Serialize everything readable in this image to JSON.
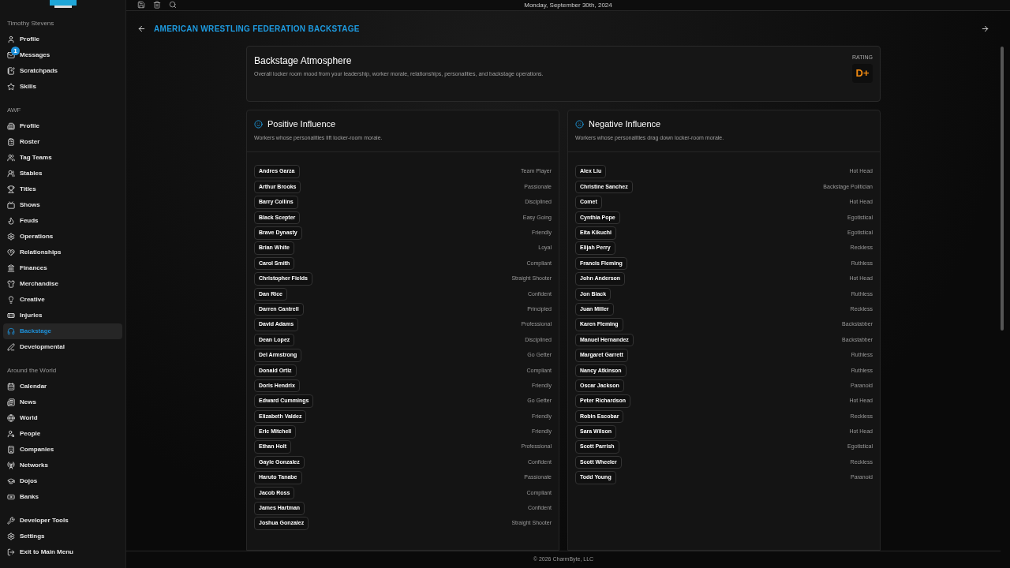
{
  "topbar": {
    "date": "Monday, September 30th, 2024"
  },
  "sidebar": {
    "sections": [
      {
        "title": "Timothy Stevens",
        "items": [
          {
            "label": "Profile",
            "selected": false
          },
          {
            "label": "Messages",
            "selected": false,
            "badge": "1"
          },
          {
            "label": "Scratchpads",
            "selected": false
          },
          {
            "label": "Skills",
            "selected": false
          }
        ]
      },
      {
        "title": "AWF",
        "items": [
          {
            "label": "Profile",
            "selected": false
          },
          {
            "label": "Roster",
            "selected": false
          },
          {
            "label": "Tag Teams",
            "selected": false
          },
          {
            "label": "Stables",
            "selected": false
          },
          {
            "label": "Titles",
            "selected": false
          },
          {
            "label": "Shows",
            "selected": false
          },
          {
            "label": "Feuds",
            "selected": false
          },
          {
            "label": "Operations",
            "selected": false
          },
          {
            "label": "Relationships",
            "selected": false
          },
          {
            "label": "Finances",
            "selected": false
          },
          {
            "label": "Merchandise",
            "selected": false
          },
          {
            "label": "Creative",
            "selected": false
          },
          {
            "label": "Injuries",
            "selected": false
          },
          {
            "label": "Backstage",
            "selected": true
          },
          {
            "label": "Developmental",
            "selected": false
          }
        ]
      },
      {
        "title": "Around the World",
        "items": [
          {
            "label": "Calendar",
            "selected": false
          },
          {
            "label": "News",
            "selected": false
          },
          {
            "label": "World",
            "selected": false
          },
          {
            "label": "People",
            "selected": false
          },
          {
            "label": "Companies",
            "selected": false
          },
          {
            "label": "Networks",
            "selected": false
          },
          {
            "label": "Dojos",
            "selected": false
          },
          {
            "label": "Banks",
            "selected": false
          }
        ]
      },
      {
        "items": [
          {
            "label": "Developer Tools",
            "selected": false
          },
          {
            "label": "Settings",
            "selected": false
          },
          {
            "label": "Exit to Main Menu",
            "selected": false
          }
        ]
      }
    ]
  },
  "page": {
    "title": "AMERICAN WRESTLING FEDERATION BACKSTAGE"
  },
  "atmosphere": {
    "title": "Backstage Atmosphere",
    "description": "Overall locker room mood from your leadership, worker morale, relationships, personalities, and backstage operations.",
    "rating_label": "RATING",
    "rating": "D+"
  },
  "columns": [
    {
      "title": "Positive Influence",
      "subtitle": "Workers whose personalities lift locker-room morale.",
      "rows": [
        {
          "name": "Andres Garza",
          "trait": "Team Player"
        },
        {
          "name": "Arthur Brooks",
          "trait": "Passionate"
        },
        {
          "name": "Barry Collins",
          "trait": "Disciplined"
        },
        {
          "name": "Black Scepter",
          "trait": "Easy Going"
        },
        {
          "name": "Brave Dynasty",
          "trait": "Friendly"
        },
        {
          "name": "Brian White",
          "trait": "Loyal"
        },
        {
          "name": "Carol Smith",
          "trait": "Compliant"
        },
        {
          "name": "Christopher Fields",
          "trait": "Straight Shooter"
        },
        {
          "name": "Dan Rice",
          "trait": "Confident"
        },
        {
          "name": "Darren Cantrell",
          "trait": "Principled"
        },
        {
          "name": "David Adams",
          "trait": "Professional"
        },
        {
          "name": "Dean Lopez",
          "trait": "Disciplined"
        },
        {
          "name": "Del Armstrong",
          "trait": "Go Getter"
        },
        {
          "name": "Donald Ortiz",
          "trait": "Compliant"
        },
        {
          "name": "Doris Hendrix",
          "trait": "Friendly"
        },
        {
          "name": "Edward Cummings",
          "trait": "Go Getter"
        },
        {
          "name": "Elizabeth Valdez",
          "trait": "Friendly"
        },
        {
          "name": "Eric Mitchell",
          "trait": "Friendly"
        },
        {
          "name": "Ethan Holt",
          "trait": "Professional"
        },
        {
          "name": "Gayle Gonzalez",
          "trait": "Confident"
        },
        {
          "name": "Haruto Tanabe",
          "trait": "Passionate"
        },
        {
          "name": "Jacob Ross",
          "trait": "Compliant"
        },
        {
          "name": "James Hartman",
          "trait": "Confident"
        },
        {
          "name": "Joshua Gonzalez",
          "trait": "Straight Shooter"
        }
      ]
    },
    {
      "title": "Negative Influence",
      "subtitle": "Workers whose personalities drag down locker-room morale.",
      "rows": [
        {
          "name": "Alex Liu",
          "trait": "Hot Head"
        },
        {
          "name": "Christine Sanchez",
          "trait": "Backstage Politician"
        },
        {
          "name": "Comet",
          "trait": "Hot Head"
        },
        {
          "name": "Cynthia Pope",
          "trait": "Egotistical"
        },
        {
          "name": "Eita Kikuchi",
          "trait": "Egotistical"
        },
        {
          "name": "Elijah Perry",
          "trait": "Reckless"
        },
        {
          "name": "Francis Fleming",
          "trait": "Ruthless"
        },
        {
          "name": "John Anderson",
          "trait": "Hot Head"
        },
        {
          "name": "Jon Black",
          "trait": "Ruthless"
        },
        {
          "name": "Juan Miller",
          "trait": "Reckless"
        },
        {
          "name": "Karen Fleming",
          "trait": "Backstabber"
        },
        {
          "name": "Manuel Hernandez",
          "trait": "Backstabber"
        },
        {
          "name": "Margaret Garrett",
          "trait": "Ruthless"
        },
        {
          "name": "Nancy Atkinson",
          "trait": "Ruthless"
        },
        {
          "name": "Oscar Jackson",
          "trait": "Paranoid"
        },
        {
          "name": "Peter Richardson",
          "trait": "Hot Head"
        },
        {
          "name": "Robin Escobar",
          "trait": "Reckless"
        },
        {
          "name": "Sara Wilson",
          "trait": "Hot Head"
        },
        {
          "name": "Scott Parrish",
          "trait": "Egotistical"
        },
        {
          "name": "Scott Wheeler",
          "trait": "Reckless"
        },
        {
          "name": "Todd Young",
          "trait": "Paranoid"
        }
      ]
    }
  ],
  "footer": "© 2026 CharmByte, LLC"
}
